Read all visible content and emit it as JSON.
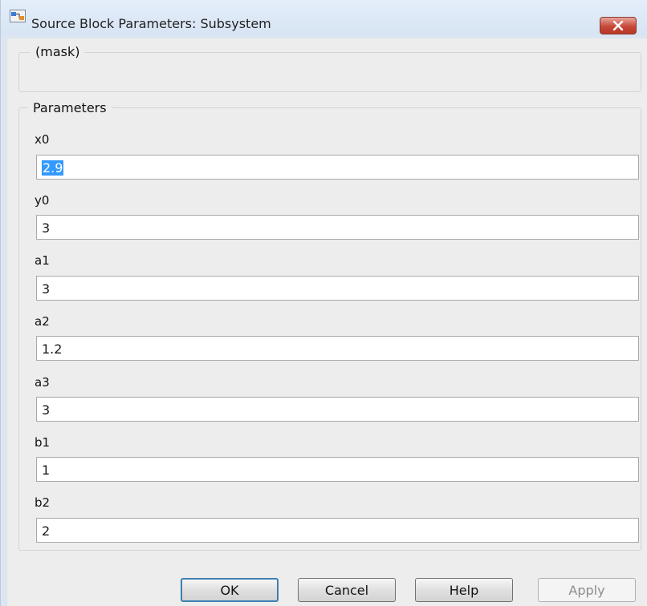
{
  "window": {
    "title": "Source Block Parameters: Subsystem",
    "close_icon": "close-icon"
  },
  "mask_group": {
    "title": "(mask)"
  },
  "parameters_group": {
    "title": "Parameters",
    "fields": [
      {
        "label": "x0",
        "value": "2.9",
        "selected": true
      },
      {
        "label": "y0",
        "value": "3"
      },
      {
        "label": "a1",
        "value": "3"
      },
      {
        "label": "a2",
        "value": "1.2"
      },
      {
        "label": "a3",
        "value": "3"
      },
      {
        "label": "b1",
        "value": "1"
      },
      {
        "label": "b2",
        "value": "2"
      }
    ]
  },
  "buttons": {
    "ok": "OK",
    "cancel": "Cancel",
    "help": "Help",
    "apply": "Apply"
  },
  "colors": {
    "selection": "#3399ff",
    "close_button": "#c8493a",
    "titlebar": "#dce6f2"
  }
}
